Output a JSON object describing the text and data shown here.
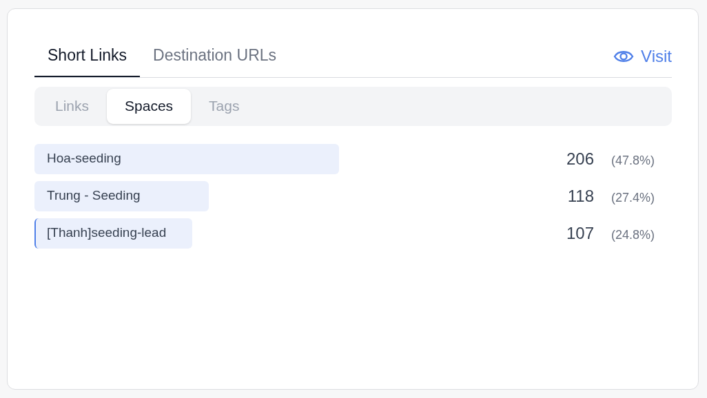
{
  "tabs": [
    {
      "label": "Short Links",
      "selected": true
    },
    {
      "label": "Destination URLs",
      "selected": false
    }
  ],
  "visit_link": {
    "label": "Visit"
  },
  "segments": [
    {
      "label": "Links",
      "selected": false
    },
    {
      "label": "Spaces",
      "selected": true
    },
    {
      "label": "Tags",
      "selected": false
    }
  ],
  "rows": [
    {
      "name": "Hoa-seeding",
      "count": "206",
      "percent": "(47.8%)",
      "highlighted": false
    },
    {
      "name": "Trung - Seeding",
      "count": "118",
      "percent": "(27.4%)",
      "highlighted": false
    },
    {
      "name": "[Thanh]seeding-lead",
      "count": "107",
      "percent": "(24.8%)",
      "highlighted": true
    }
  ]
}
